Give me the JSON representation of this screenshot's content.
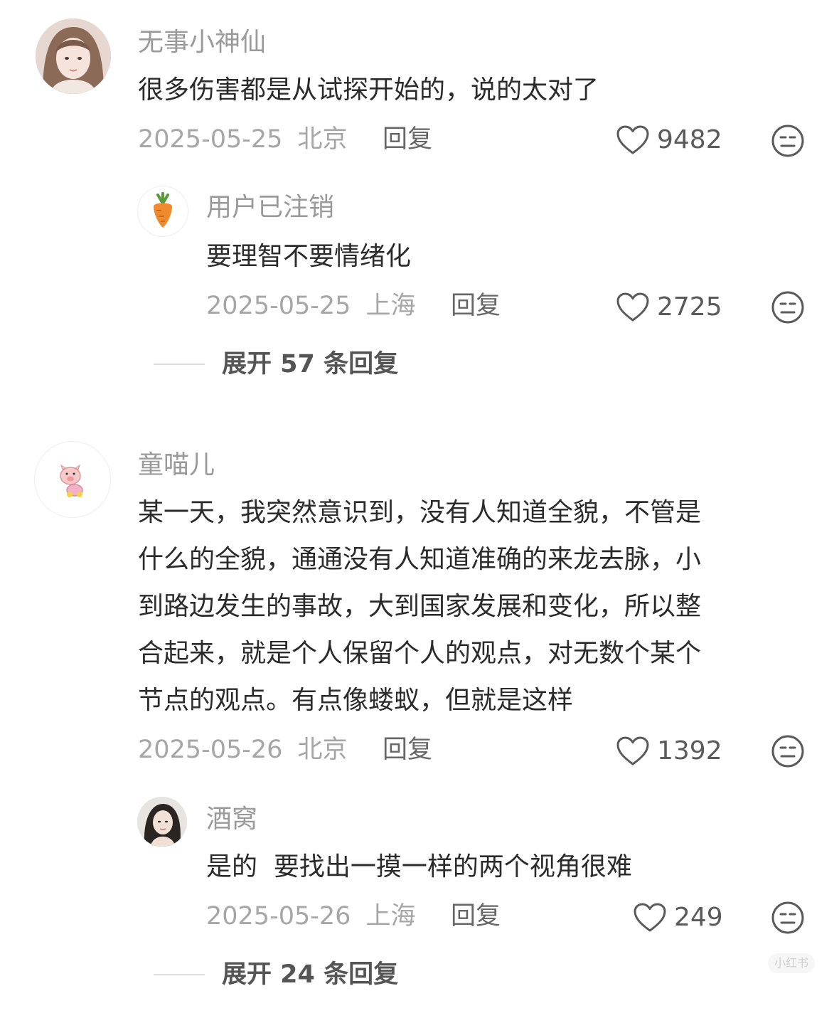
{
  "comments": [
    {
      "username": "无事小神仙",
      "text": "很多伤害都是从试探开始的，说的太对了",
      "date": "2025-05-25",
      "location": "北京",
      "reply_label": "回复",
      "likes": "9482",
      "avatar_icon": "girl-photo-avatar",
      "replies": [
        {
          "username": "用户已注销",
          "text": "要理智不要情绪化",
          "date": "2025-05-25",
          "location": "上海",
          "reply_label": "回复",
          "likes": "2725",
          "avatar_icon": "carrot-avatar"
        }
      ],
      "expand_label": "展开 57 条回复"
    },
    {
      "username": "童喵儿",
      "text_lines": [
        "某一天，我突然意识到，没有人知道全貌，不管是",
        "什么的全貌，通通没有人知道准确的来龙去脉，小",
        "到路边发生的事故，大到国家发展和变化，所以整",
        "合起来，就是个人保留个人的观点，对无数个某个",
        "节点的观点。有点像蝼蚁，但就是这样"
      ],
      "date": "2025-05-26",
      "location": "北京",
      "reply_label": "回复",
      "likes": "1392",
      "avatar_icon": "pig-cartoon-avatar",
      "replies": [
        {
          "username": "酒窝",
          "text": "是的  要找出一摸一样的两个视角很难",
          "date": "2025-05-26",
          "location": "上海",
          "reply_label": "回复",
          "likes": "249",
          "avatar_icon": "woman-photo-avatar"
        }
      ],
      "expand_label": "展开 24 条回复"
    }
  ],
  "watermark": "小红书",
  "icons": {
    "like": "heart-outline-icon",
    "dislike": "meh-face-icon"
  },
  "colors": {
    "username": "#9a9a9a",
    "content": "#2b2b2b",
    "meta": "#a6a6a6"
  }
}
